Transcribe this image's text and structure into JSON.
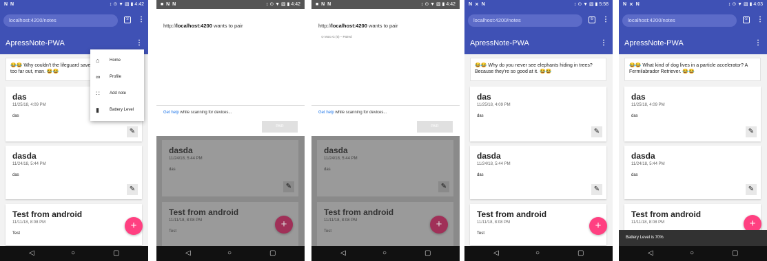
{
  "colors": {
    "primary": "#3f51b5",
    "accent": "#ff4081",
    "nav": "#111111"
  },
  "status": {
    "left_menu": "N N",
    "left_dialog": "■ N N",
    "left_p4": "N ⨯ N",
    "icons": "↕ ⊙ ▼ ▧ ▮",
    "times": [
      "4:42",
      "4:42",
      "4:42",
      "5:58",
      "4:03"
    ]
  },
  "url": "localhost:4200/notes",
  "tab_icon": "①",
  "app_title": "ApressNote-PWA",
  "jokes": [
    "😂😂 Why couldn't the lifeguard save the hippie? He was too far out, man. 😂😂",
    "😂😂 Why do you never see elephants hiding in trees? Because they're so good at it. 😂😂",
    "😂😂 What kind of dog lives in a particle accelerator? A Fermilabrador Retriever. 😂😂"
  ],
  "notes": [
    {
      "title": "das",
      "date": "11/25/18, 4:09 PM",
      "body": "das"
    },
    {
      "title": "dasda",
      "date": "11/24/18, 5:44 PM",
      "body": "das"
    },
    {
      "title": "Test from android",
      "date": "11/11/18, 8:08 PM",
      "body": "Test"
    }
  ],
  "menu": [
    {
      "label": "Home",
      "icon": "home-icon",
      "glyph": "⌂"
    },
    {
      "label": "Profile",
      "icon": "voicemail-icon",
      "glyph": "∞"
    },
    {
      "label": "Add note",
      "icon": "grid-icon",
      "glyph": "∷"
    },
    {
      "label": "Battery Level",
      "icon": "battery-icon",
      "glyph": "▮"
    }
  ],
  "pair_dialog": {
    "prefix": "http://",
    "host": "localhost:4200",
    "suffix": " wants to pair",
    "device": "⊙  Moto G (5) – Paired",
    "help_link": "Get help",
    "help_text": " while scanning for devices...",
    "pair_button": "PAIR"
  },
  "snackbar": "Battery Level is 70%",
  "glyphs": {
    "edit": "✎",
    "fab": "+",
    "kebab": "⋮",
    "back": "◁",
    "home": "○",
    "recents": "▢"
  }
}
